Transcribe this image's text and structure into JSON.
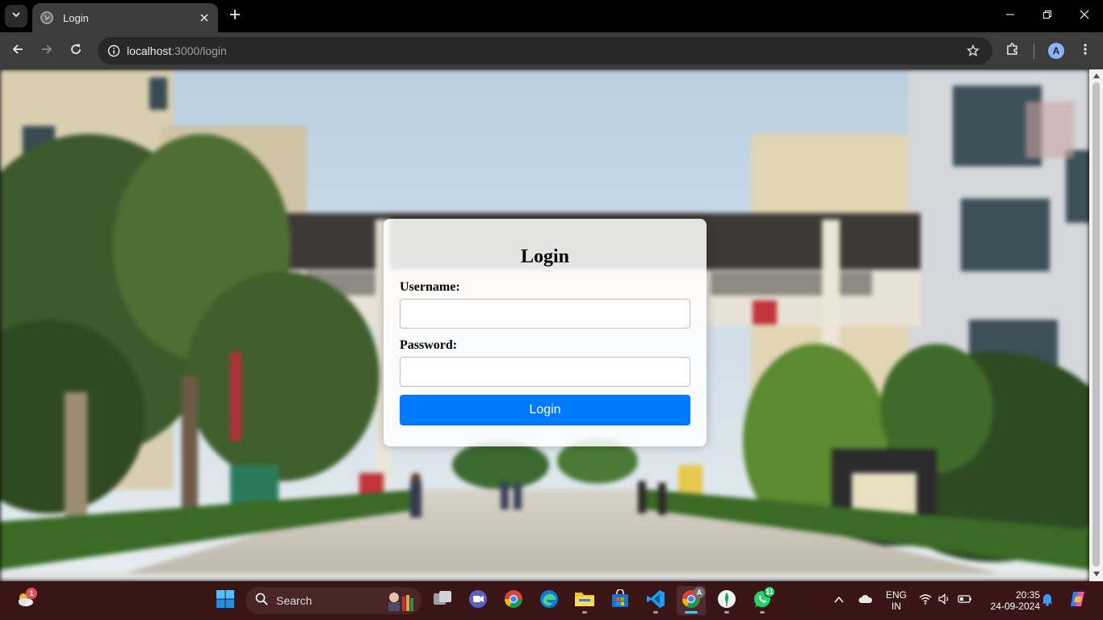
{
  "browser": {
    "tab_title": "Login",
    "url_host": "localhost",
    "url_path": ":3000/login",
    "profile_initial": "A"
  },
  "login": {
    "title": "Login",
    "username_label": "Username:",
    "username_value": "",
    "password_label": "Password:",
    "password_value": "",
    "submit_label": "Login",
    "accent_color": "#007bff"
  },
  "taskbar": {
    "weather_badge": "1",
    "search_label": "Search",
    "chrome_profile_badge": "A",
    "whatsapp_badge": "11",
    "lang_primary": "ENG",
    "lang_secondary": "IN",
    "time": "20:35",
    "date": "24-09-2024",
    "background_color": "#3a1516"
  }
}
